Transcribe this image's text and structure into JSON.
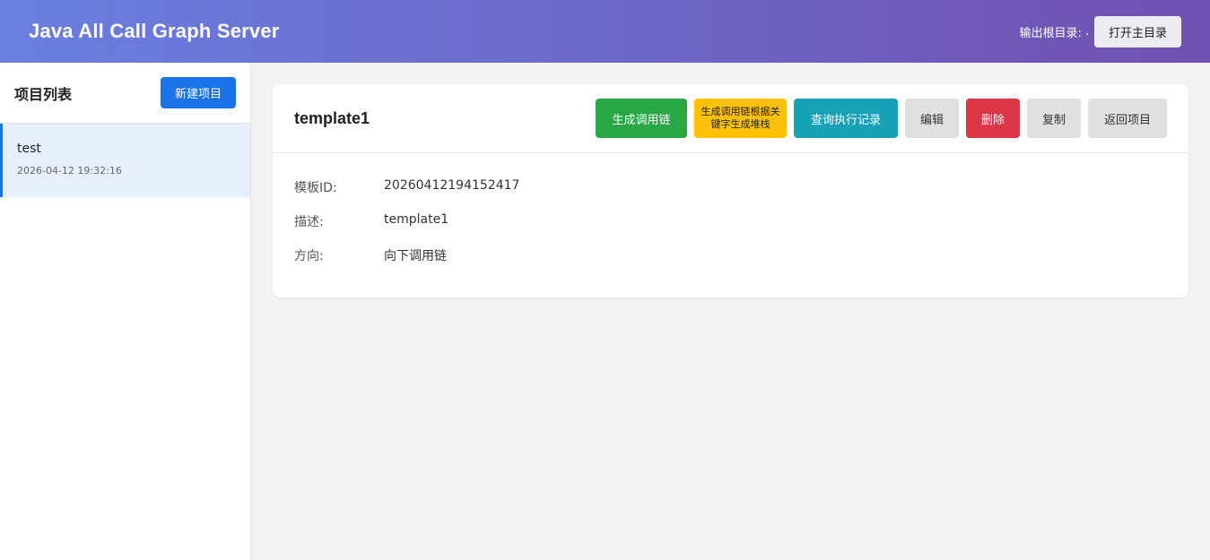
{
  "header": {
    "title": "Java All Call Graph Server",
    "root_label": "输出根目录:",
    "root_value": ".",
    "open_root_button": "打开主目录"
  },
  "sidebar": {
    "title": "项目列表",
    "new_project_button": "新建项目",
    "projects": [
      {
        "name": "test",
        "time": "2026-04-12 19:32:16"
      }
    ]
  },
  "template": {
    "title": "template1",
    "actions": {
      "generate_chain": "生成调用链",
      "generate_stack": "生成调用链根据关键字生成堆栈",
      "query_records": "查询执行记录",
      "edit": "编辑",
      "delete": "删除",
      "copy": "复制",
      "back": "返回项目"
    },
    "fields": [
      {
        "label": "模板ID:",
        "value": "20260412194152417"
      },
      {
        "label": "描述:",
        "value": "template1"
      },
      {
        "label": "方向:",
        "value": "向下调用链"
      }
    ]
  },
  "colors": {
    "header_gradient_start": "#6a7fe0",
    "header_gradient_end": "#7050b0",
    "primary": "#1a73e8",
    "success": "#28a745",
    "warning": "#ffc107",
    "info": "#17a2b8",
    "danger": "#dc3545"
  }
}
